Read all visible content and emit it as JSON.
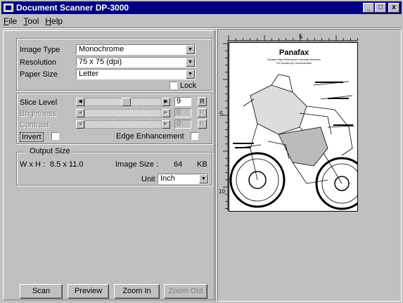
{
  "window": {
    "title": "Document Scanner  DP-3000",
    "buttons": {
      "minimize": "_",
      "maximize": "□",
      "close": "x"
    }
  },
  "menu": [
    {
      "label": "File",
      "underline": "F"
    },
    {
      "label": "Tool",
      "underline": "T"
    },
    {
      "label": "Help",
      "underline": "H"
    }
  ],
  "scan_settings": {
    "image_type_label": "Image Type",
    "image_type_value": "Monochrome",
    "resolution_label": "Resolution",
    "resolution_value": "75 x 75 (dpi)",
    "paper_size_label": "Paper Size",
    "paper_size_value": "Letter",
    "lock_label": "Lock",
    "lock_checked": false
  },
  "adjustments": {
    "slice_level_label": "Slice Level",
    "slice_level_value": "9",
    "slice_level_pos": 0.55,
    "brightness_label": "Brightness",
    "brightness_value": "0",
    "contrast_label": "Contrast",
    "contrast_value": "0",
    "r_label": "R",
    "invert_label": "Invert",
    "edge_label": "Edge Enhancement"
  },
  "output": {
    "group_label": "Output Size",
    "wxh_label": "W x H :",
    "wxh_value": "8.5 x 11.0",
    "image_size_label": "Image Size :",
    "image_size_value": "64",
    "image_size_unit": "KB",
    "unit_label": "Unit",
    "unit_value": "Inch"
  },
  "buttons": {
    "scan": "Scan",
    "preview": "Preview",
    "zoom_in": "Zoom In",
    "zoom_out": "Zoom Out"
  },
  "preview": {
    "ruler_top_mark": "5",
    "ruler_left_mark_5": "5",
    "ruler_left_mark_10": "10",
    "doc_brand": "Panafax",
    "doc_subtitle_1": "Panafax High Performance Facsimile Machines",
    "doc_subtitle_2": "For Souped-Up Communication"
  }
}
